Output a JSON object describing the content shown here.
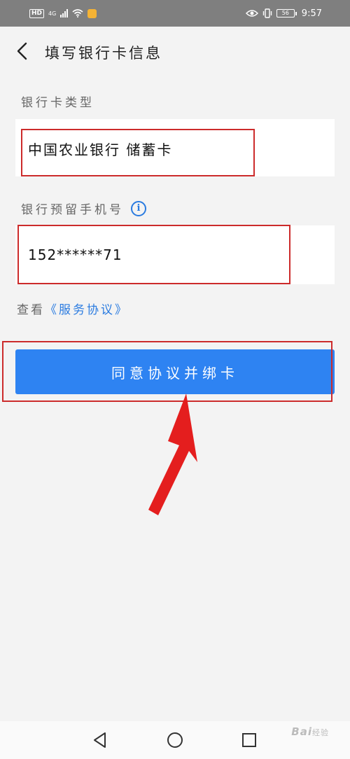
{
  "status_bar": {
    "hd": "HD",
    "network": "4G",
    "battery": "56",
    "time": "9:57",
    "icons": [
      "signal-icon",
      "wifi-icon",
      "app-notification-icon",
      "eye-comfort-icon",
      "vibrate-icon",
      "battery-icon"
    ]
  },
  "header": {
    "title": "填写银行卡信息",
    "back_icon": "chevron-left-icon"
  },
  "card_type": {
    "label": "银行卡类型",
    "value": "中国农业银行 储蓄卡"
  },
  "phone": {
    "label": "银行预留手机号",
    "info_icon": "i",
    "value": "152******71"
  },
  "agreement": {
    "prefix": "查看",
    "link": "《服务协议》"
  },
  "bind_button": {
    "label": "同意协议并绑卡"
  },
  "nav_bar": {
    "icons": [
      "nav-back-icon",
      "nav-home-icon",
      "nav-recent-icon"
    ]
  },
  "watermark": {
    "text": "Bai",
    "suffix": "经验"
  },
  "colors": {
    "accent": "#2e83f2",
    "link": "#2a7be0",
    "annotation": "#cc2b2b",
    "arrow": "#e41e1e",
    "status_bar": "#7f7f7f",
    "background": "#f3f3f3"
  }
}
